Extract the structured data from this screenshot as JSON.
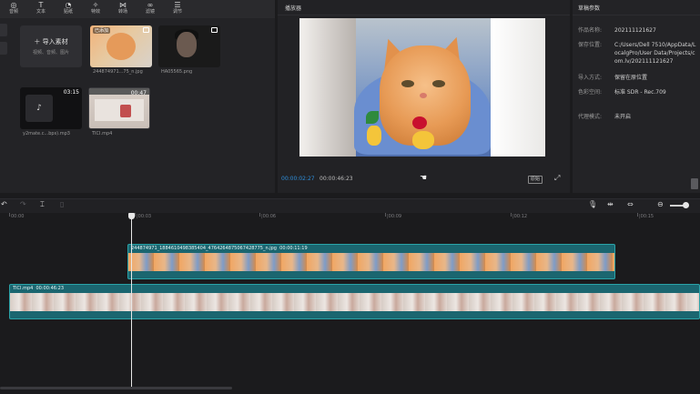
{
  "toolbar": {
    "items": [
      {
        "label": "音频",
        "icon": "audio-icon"
      },
      {
        "label": "文本",
        "icon": "text-icon"
      },
      {
        "label": "贴纸",
        "icon": "sticker-icon"
      },
      {
        "label": "特效",
        "icon": "effects-icon"
      },
      {
        "label": "转场",
        "icon": "transition-icon"
      },
      {
        "label": "滤镜",
        "icon": "filter-icon"
      },
      {
        "label": "调节",
        "icon": "adjust-icon"
      }
    ]
  },
  "media": {
    "import_label": "导入素材",
    "import_sub": "视频、音频、图片",
    "files": [
      {
        "name": "244874971...75_n.jpg",
        "badge": "已添加"
      },
      {
        "name": "HA05565.png"
      },
      {
        "name": "y2mate.c...bps).mp3",
        "duration": "03:15"
      },
      {
        "name": "TICI.mp4",
        "duration": "00:47"
      }
    ]
  },
  "player": {
    "title": "播放器",
    "current_time": "00:00:02:27",
    "total_time": "00:00:46:23",
    "ratio_label": "原始"
  },
  "params": {
    "title": "草稿参数",
    "rows": [
      {
        "key": "作品名称:",
        "value": "202111121627"
      },
      {
        "key": "保存位置:",
        "value": "C:/Users/Dell 7510/AppData/LocalgPro/User Data/Projects/com.lv/202111121627"
      },
      {
        "key": "导入方式:",
        "value": "保留在原位置"
      },
      {
        "key": "色彩空间:",
        "value": "标准 SDR - Rec.709"
      },
      {
        "key": "代理模式:",
        "value": "未开启"
      }
    ]
  },
  "timeline": {
    "ruler": [
      "00:00",
      "|00:03",
      "|00:06",
      "|00:09",
      "|00:12",
      "|00:15"
    ],
    "clips": [
      {
        "name": "244874971_1884610498385404_4764264875067428775_n.jpg",
        "duration": "00:00:11:19"
      },
      {
        "name": "TICI.mp4",
        "duration": "00:00:46:23"
      }
    ]
  },
  "colors": {
    "accent": "#2e8fdc",
    "clip": "#1b6670",
    "clip_border": "#2aa3a8"
  }
}
